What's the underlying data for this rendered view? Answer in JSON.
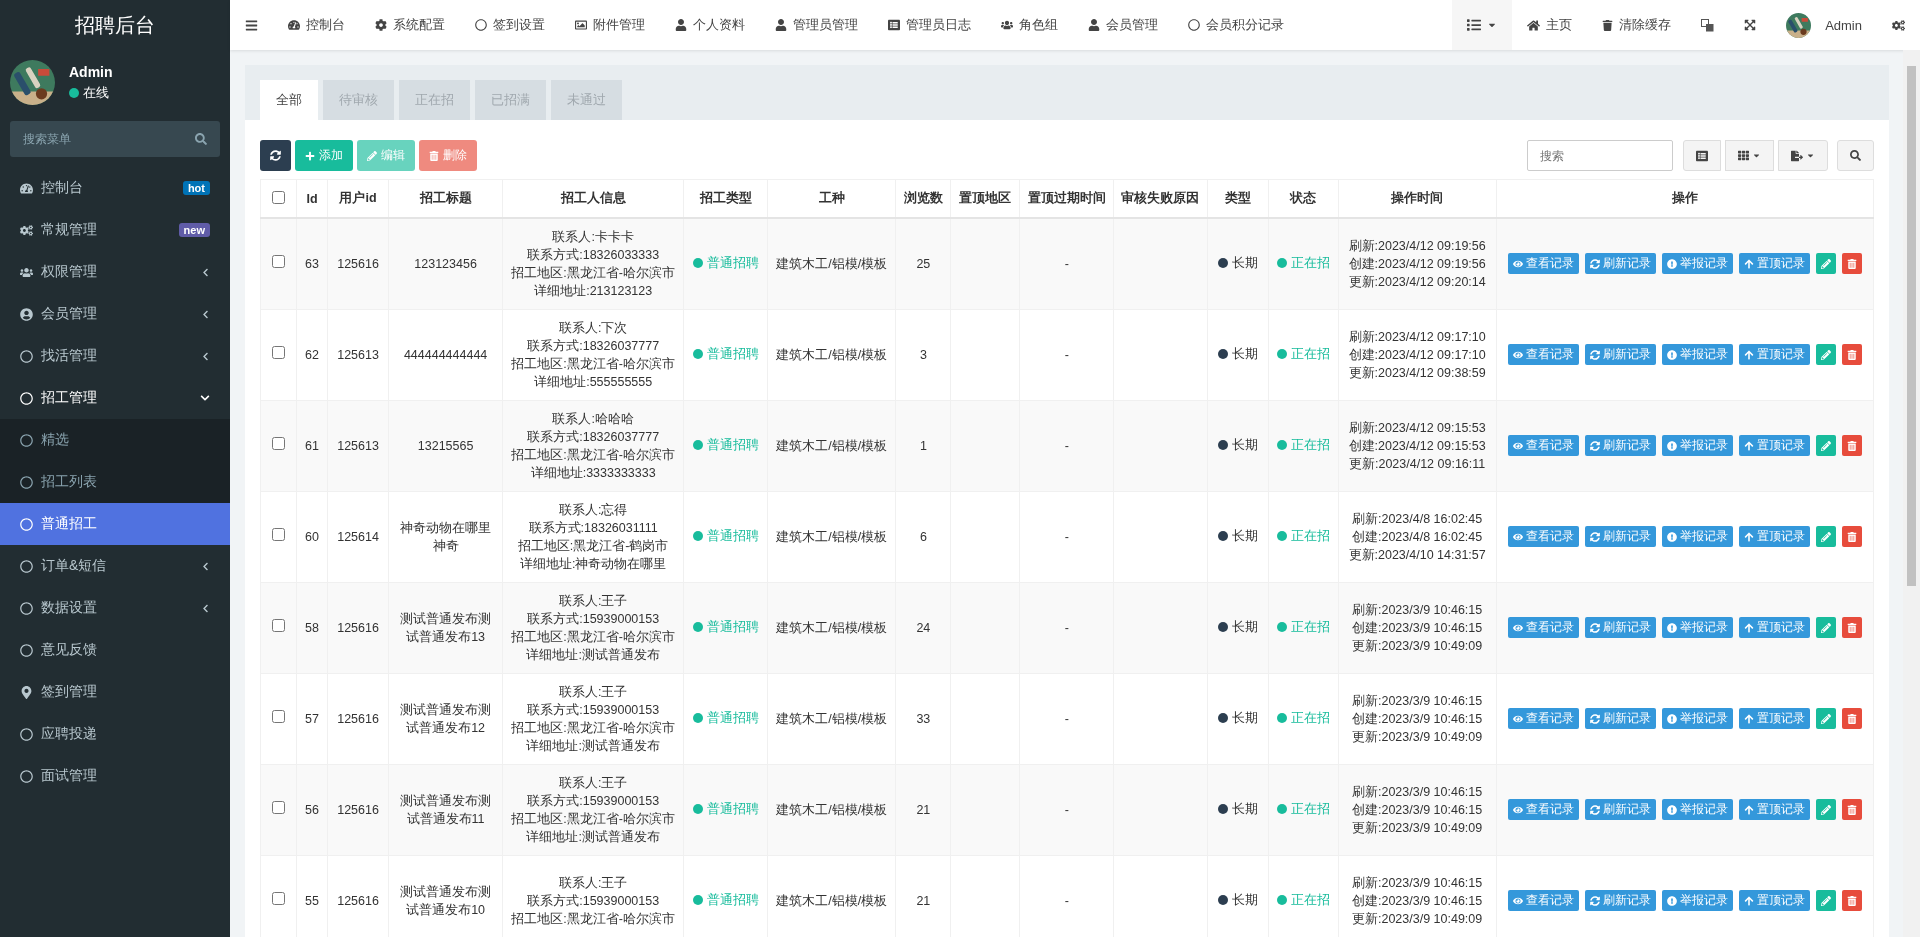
{
  "brand": "招聘后台",
  "user": {
    "name": "Admin",
    "status": "在线",
    "online": true
  },
  "sidebar": {
    "search": {
      "placeholder": "搜索菜单"
    },
    "items": [
      {
        "label": "控制台",
        "badge": {
          "text": "hot",
          "color": "#0073b7"
        }
      },
      {
        "label": "常规管理",
        "badge": {
          "text": "new",
          "color": "#605ca8"
        }
      },
      {
        "label": "权限管理",
        "expanded": false
      },
      {
        "label": "会员管理",
        "expanded": false
      },
      {
        "label": "找活管理",
        "expanded": false
      },
      {
        "label": "招工管理",
        "expanded": true,
        "children": [
          {
            "label": "精选",
            "selected": false
          },
          {
            "label": "招工列表",
            "selected": false
          },
          {
            "label": "普通招工",
            "selected": true
          }
        ]
      },
      {
        "label": "订单&短信",
        "expanded": false
      },
      {
        "label": "数据设置",
        "expanded": false
      },
      {
        "label": "意见反馈"
      },
      {
        "label": "签到管理"
      },
      {
        "label": "应聘投递"
      },
      {
        "label": "面试管理"
      }
    ]
  },
  "topnav": {
    "items": [
      "控制台",
      "系统配置",
      "签到设置",
      "附件管理",
      "个人资料",
      "管理员管理",
      "管理员日志",
      "角色组",
      "会员管理",
      "会员积分记录"
    ],
    "right": {
      "home": "主页",
      "clear_cache": "清除缓存",
      "user": "Admin"
    }
  },
  "tabs": [
    {
      "label": "全部",
      "selected": true
    },
    {
      "label": "待审核",
      "selected": false
    },
    {
      "label": "正在招",
      "selected": false
    },
    {
      "label": "已招满",
      "selected": false
    },
    {
      "label": "未通过",
      "selected": false
    }
  ],
  "toolbar": {
    "add": {
      "label": "添加",
      "disabled": false
    },
    "edit": {
      "label": "编辑",
      "disabled": true
    },
    "delete": {
      "label": "删除",
      "disabled": true
    },
    "search": {
      "placeholder": "搜索"
    }
  },
  "table": {
    "select_all": {
      "checked": false
    },
    "columns": [
      "Id",
      "用户id",
      "招工标题",
      "招工人信息",
      "招工类型",
      "工种",
      "浏览数",
      "置顶地区",
      "置顶过期时间",
      "审核失败原因",
      "类型",
      "状态",
      "操作时间",
      "操作"
    ],
    "rows": [
      {
        "checked": false,
        "id": "63",
        "user_id": "125616",
        "title": "123123456",
        "info": [
          "联系人:卡卡卡",
          "联系方式:18326033333",
          "招工地区:黑龙江省-哈尔滨市",
          "详细地址:213123123"
        ],
        "recruit_type": {
          "text": "普通招聘",
          "color": "#18bc9c"
        },
        "trade": "建筑木工/铝模/模板",
        "views": "25",
        "top_expire": "-",
        "term": {
          "text": "长期",
          "color": "#2c3e50"
        },
        "status": {
          "text": "正在招",
          "color": "#18bc9c"
        },
        "times": [
          "刷新:2023/4/12 09:19:56",
          "创建:2023/4/12 09:19:56",
          "更新:2023/4/12 09:20:14"
        ],
        "actions": [
          "查看记录",
          "刷新记录",
          "举报记录",
          "置顶记录"
        ]
      },
      {
        "checked": false,
        "id": "62",
        "user_id": "125613",
        "title": "444444444444",
        "info": [
          "联系人:下次",
          "联系方式:18326037777",
          "招工地区:黑龙江省-哈尔滨市",
          "详细地址:555555555"
        ],
        "recruit_type": {
          "text": "普通招聘",
          "color": "#18bc9c"
        },
        "trade": "建筑木工/铝模/模板",
        "views": "3",
        "top_expire": "-",
        "term": {
          "text": "长期",
          "color": "#2c3e50"
        },
        "status": {
          "text": "正在招",
          "color": "#18bc9c"
        },
        "times": [
          "刷新:2023/4/12 09:17:10",
          "创建:2023/4/12 09:17:10",
          "更新:2023/4/12 09:38:59"
        ],
        "actions": [
          "查看记录",
          "刷新记录",
          "举报记录",
          "置顶记录"
        ]
      },
      {
        "checked": false,
        "id": "61",
        "user_id": "125613",
        "title": "13215565",
        "info": [
          "联系人:哈哈哈",
          "联系方式:18326037777",
          "招工地区:黑龙江省-哈尔滨市",
          "详细地址:3333333333"
        ],
        "recruit_type": {
          "text": "普通招聘",
          "color": "#18bc9c"
        },
        "trade": "建筑木工/铝模/模板",
        "views": "1",
        "top_expire": "-",
        "term": {
          "text": "长期",
          "color": "#2c3e50"
        },
        "status": {
          "text": "正在招",
          "color": "#18bc9c"
        },
        "times": [
          "刷新:2023/4/12 09:15:53",
          "创建:2023/4/12 09:15:53",
          "更新:2023/4/12 09:16:11"
        ],
        "actions": [
          "查看记录",
          "刷新记录",
          "举报记录",
          "置顶记录"
        ]
      },
      {
        "checked": false,
        "id": "60",
        "user_id": "125614",
        "title": "神奇动物在哪里神奇",
        "info": [
          "联系人:忘得",
          "联系方式:18326031111",
          "招工地区:黑龙江省-鹤岗市",
          "详细地址:神奇动物在哪里"
        ],
        "recruit_type": {
          "text": "普通招聘",
          "color": "#18bc9c"
        },
        "trade": "建筑木工/铝模/模板",
        "views": "6",
        "top_expire": "-",
        "term": {
          "text": "长期",
          "color": "#2c3e50"
        },
        "status": {
          "text": "正在招",
          "color": "#18bc9c"
        },
        "times": [
          "刷新:2023/4/8 16:02:45",
          "创建:2023/4/8 16:02:45",
          "更新:2023/4/10 14:31:57"
        ],
        "actions": [
          "查看记录",
          "刷新记录",
          "举报记录",
          "置顶记录"
        ]
      },
      {
        "checked": false,
        "id": "58",
        "user_id": "125616",
        "title": "测试普通发布测试普通发布13",
        "info": [
          "联系人:王子",
          "联系方式:15939000153",
          "招工地区:黑龙江省-哈尔滨市",
          "详细地址:测试普通发布"
        ],
        "recruit_type": {
          "text": "普通招聘",
          "color": "#18bc9c"
        },
        "trade": "建筑木工/铝模/模板",
        "views": "24",
        "top_expire": "-",
        "term": {
          "text": "长期",
          "color": "#2c3e50"
        },
        "status": {
          "text": "正在招",
          "color": "#18bc9c"
        },
        "times": [
          "刷新:2023/3/9 10:46:15",
          "创建:2023/3/9 10:46:15",
          "更新:2023/3/9 10:49:09"
        ],
        "actions": [
          "查看记录",
          "刷新记录",
          "举报记录",
          "置顶记录"
        ]
      },
      {
        "checked": false,
        "id": "57",
        "user_id": "125616",
        "title": "测试普通发布测试普通发布12",
        "info": [
          "联系人:王子",
          "联系方式:15939000153",
          "招工地区:黑龙江省-哈尔滨市",
          "详细地址:测试普通发布"
        ],
        "recruit_type": {
          "text": "普通招聘",
          "color": "#18bc9c"
        },
        "trade": "建筑木工/铝模/模板",
        "views": "33",
        "top_expire": "-",
        "term": {
          "text": "长期",
          "color": "#2c3e50"
        },
        "status": {
          "text": "正在招",
          "color": "#18bc9c"
        },
        "times": [
          "刷新:2023/3/9 10:46:15",
          "创建:2023/3/9 10:46:15",
          "更新:2023/3/9 10:49:09"
        ],
        "actions": [
          "查看记录",
          "刷新记录",
          "举报记录",
          "置顶记录"
        ]
      },
      {
        "checked": false,
        "id": "56",
        "user_id": "125616",
        "title": "测试普通发布测试普通发布11",
        "info": [
          "联系人:王子",
          "联系方式:15939000153",
          "招工地区:黑龙江省-哈尔滨市",
          "详细地址:测试普通发布"
        ],
        "recruit_type": {
          "text": "普通招聘",
          "color": "#18bc9c"
        },
        "trade": "建筑木工/铝模/模板",
        "views": "21",
        "top_expire": "-",
        "term": {
          "text": "长期",
          "color": "#2c3e50"
        },
        "status": {
          "text": "正在招",
          "color": "#18bc9c"
        },
        "times": [
          "刷新:2023/3/9 10:46:15",
          "创建:2023/3/9 10:46:15",
          "更新:2023/3/9 10:49:09"
        ],
        "actions": [
          "查看记录",
          "刷新记录",
          "举报记录",
          "置顶记录"
        ]
      },
      {
        "checked": false,
        "id": "55",
        "user_id": "125616",
        "title": "测试普通发布测试普通发布10",
        "info": [
          "联系人:王子",
          "联系方式:15939000153",
          "招工地区:黑龙江省-哈尔滨市"
        ],
        "recruit_type": {
          "text": "普通招聘",
          "color": "#18bc9c"
        },
        "trade": "建筑木工/铝模/模板",
        "views": "21",
        "top_expire": "-",
        "term": {
          "text": "长期",
          "color": "#2c3e50"
        },
        "status": {
          "text": "正在招",
          "color": "#18bc9c"
        },
        "times": [
          "刷新:2023/3/9 10:46:15",
          "创建:2023/3/9 10:46:15",
          "更新:2023/3/9 10:49:09"
        ],
        "actions": [
          "查看记录",
          "刷新记录",
          "举报记录",
          "置顶记录"
        ]
      }
    ]
  }
}
